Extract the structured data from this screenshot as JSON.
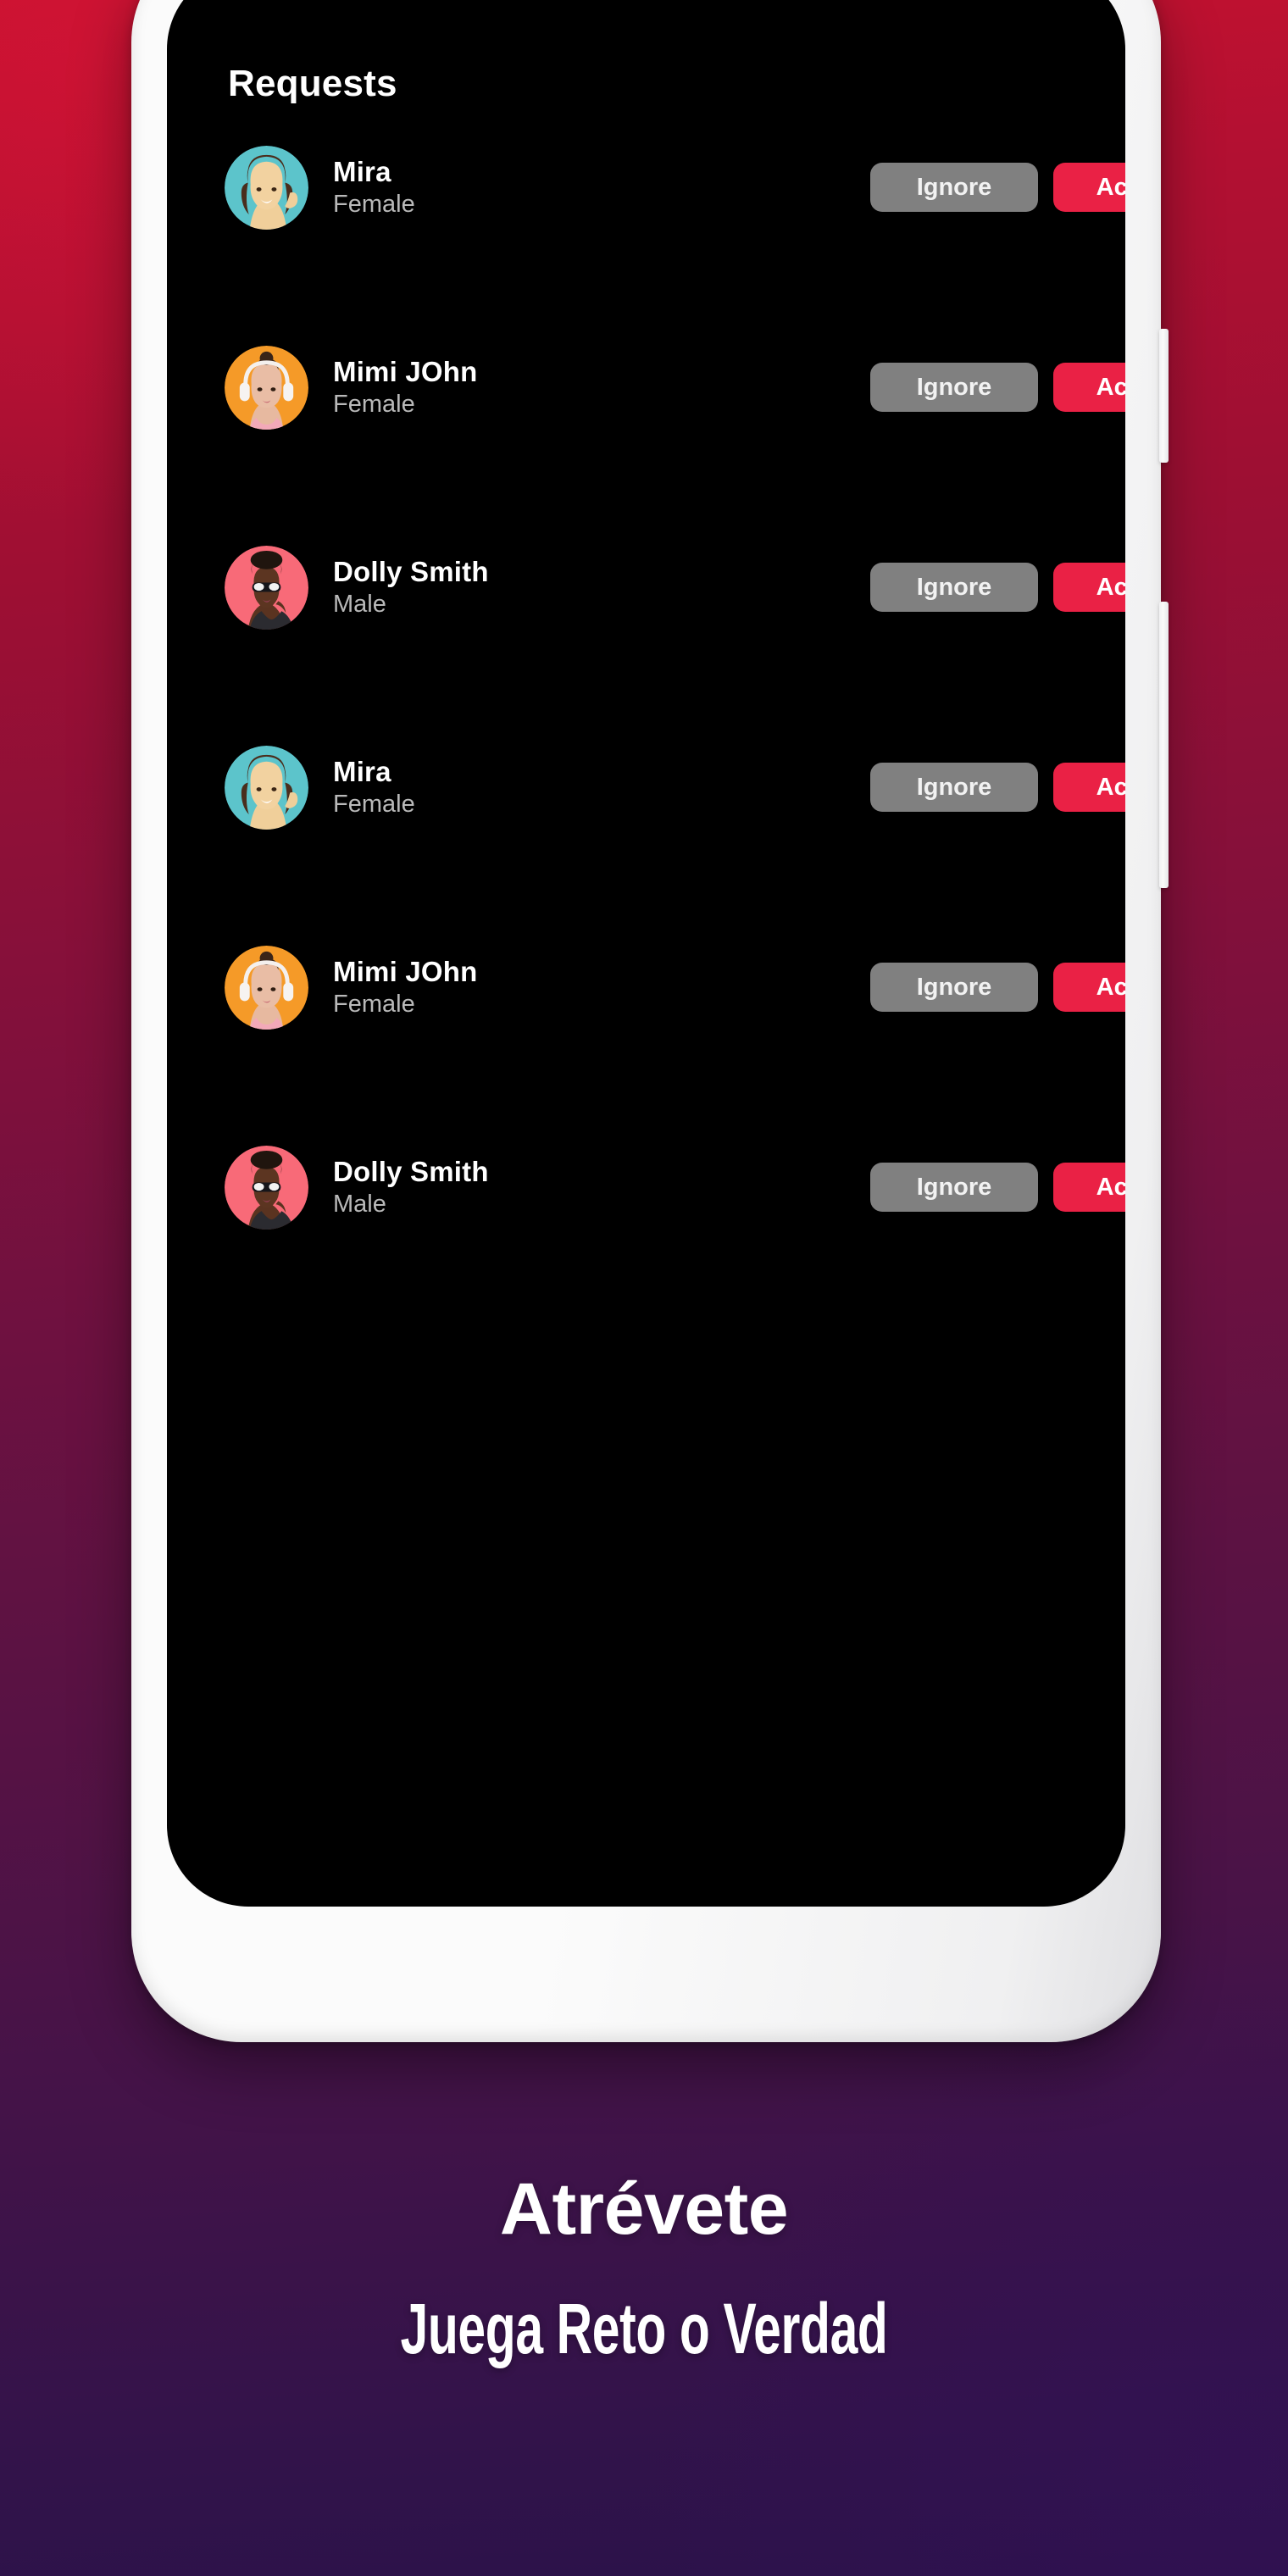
{
  "promo": {
    "caption_primary": "Atrévete",
    "caption_secondary": "Juega Reto o Verdad",
    "bg_top_color": "#c6122f",
    "bg_bottom_color": "#2a124a"
  },
  "phone": {
    "bezel_color": "#fbfbfb",
    "screen_bg": "#000000",
    "side_buttons": [
      {
        "name": "volume-rocker"
      },
      {
        "name": "power-button"
      }
    ]
  },
  "screen": {
    "title": "Requests",
    "actions": {
      "ignore_label": "Ignore",
      "accept_label": "Accept",
      "ignore_color": "#808080",
      "accept_color": "#ea2145"
    },
    "requests": [
      {
        "name": "Mira",
        "gender": "Female",
        "avatar_bg": "#5cc4cb",
        "avatar_type": "woman-hand-to-ear"
      },
      {
        "name": "Mimi JOhn",
        "gender": "Female",
        "avatar_bg": "#f59a28",
        "avatar_type": "woman-headphones"
      },
      {
        "name": "Dolly Smith",
        "gender": "Male",
        "avatar_bg": "#f86a78",
        "avatar_type": "person-sunglasses"
      },
      {
        "name": "Mira",
        "gender": "Female",
        "avatar_bg": "#5cc4cb",
        "avatar_type": "woman-hand-to-ear"
      },
      {
        "name": "Mimi JOhn",
        "gender": "Female",
        "avatar_bg": "#f59a28",
        "avatar_type": "woman-headphones"
      },
      {
        "name": "Dolly Smith",
        "gender": "Male",
        "avatar_bg": "#f86a78",
        "avatar_type": "person-sunglasses"
      }
    ]
  }
}
